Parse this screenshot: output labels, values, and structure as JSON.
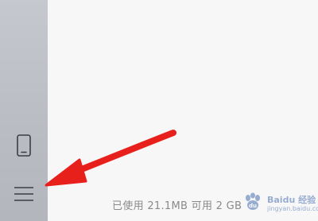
{
  "sidebar": {
    "device_icon": "phone-icon",
    "menu_icon": "hamburger-menu-icon",
    "background_color": "#bcbfc5"
  },
  "storage": {
    "text": "已使用 21.1MB 可用 2 GB"
  },
  "annotation": {
    "arrow_color": "#e8201c",
    "arrow_icon": "red-arrow-pointer"
  },
  "watermark": {
    "brand": "Baidu 经验",
    "url": "jingyan.baidu.com"
  }
}
